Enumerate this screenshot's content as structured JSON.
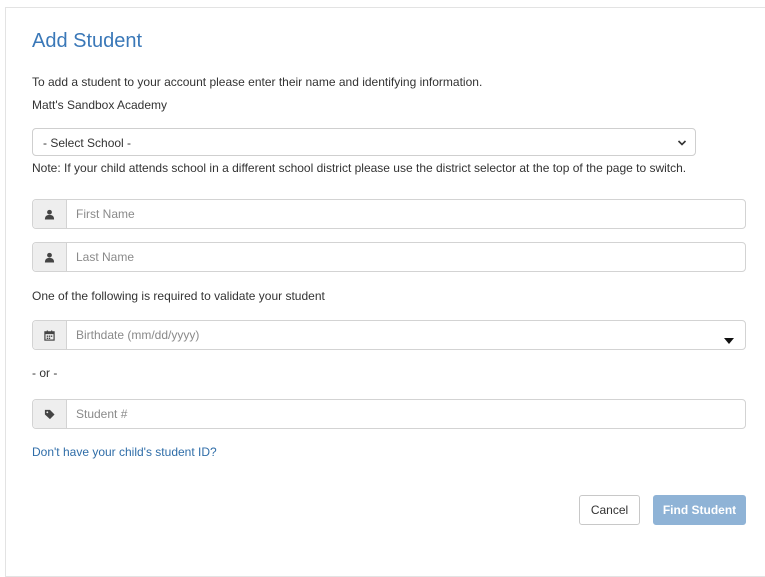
{
  "page": {
    "title": "Add Student",
    "intro": "To add a student to your account please enter their name and identifying information.",
    "district_name": "Matt's Sandbox Academy",
    "school_select": {
      "value": "- Select School -"
    },
    "school_note": "Note: If your child attends school in a different school district please use the district selector at the top of the page to switch.",
    "first_name": {
      "placeholder": "First Name",
      "value": "",
      "icon": "user-icon"
    },
    "last_name": {
      "placeholder": "Last Name",
      "value": "",
      "icon": "user-icon"
    },
    "validation_text": "One of the following is required to validate your student",
    "birthdate": {
      "placeholder": "Birthdate (mm/dd/yyyy)",
      "value": "",
      "icon": "calendar-icon"
    },
    "or_text": "- or -",
    "student_number": {
      "placeholder": "Student #",
      "value": "",
      "icon": "tag-icon"
    },
    "missing_id_link": "Don't have your child's student ID?",
    "cancel_label": "Cancel",
    "find_label": "Find Student"
  },
  "colors": {
    "title": "#3a78b8",
    "link": "#2f6da8",
    "primary_button": "#8fb3d6",
    "addon_bg": "#eeeeee"
  }
}
